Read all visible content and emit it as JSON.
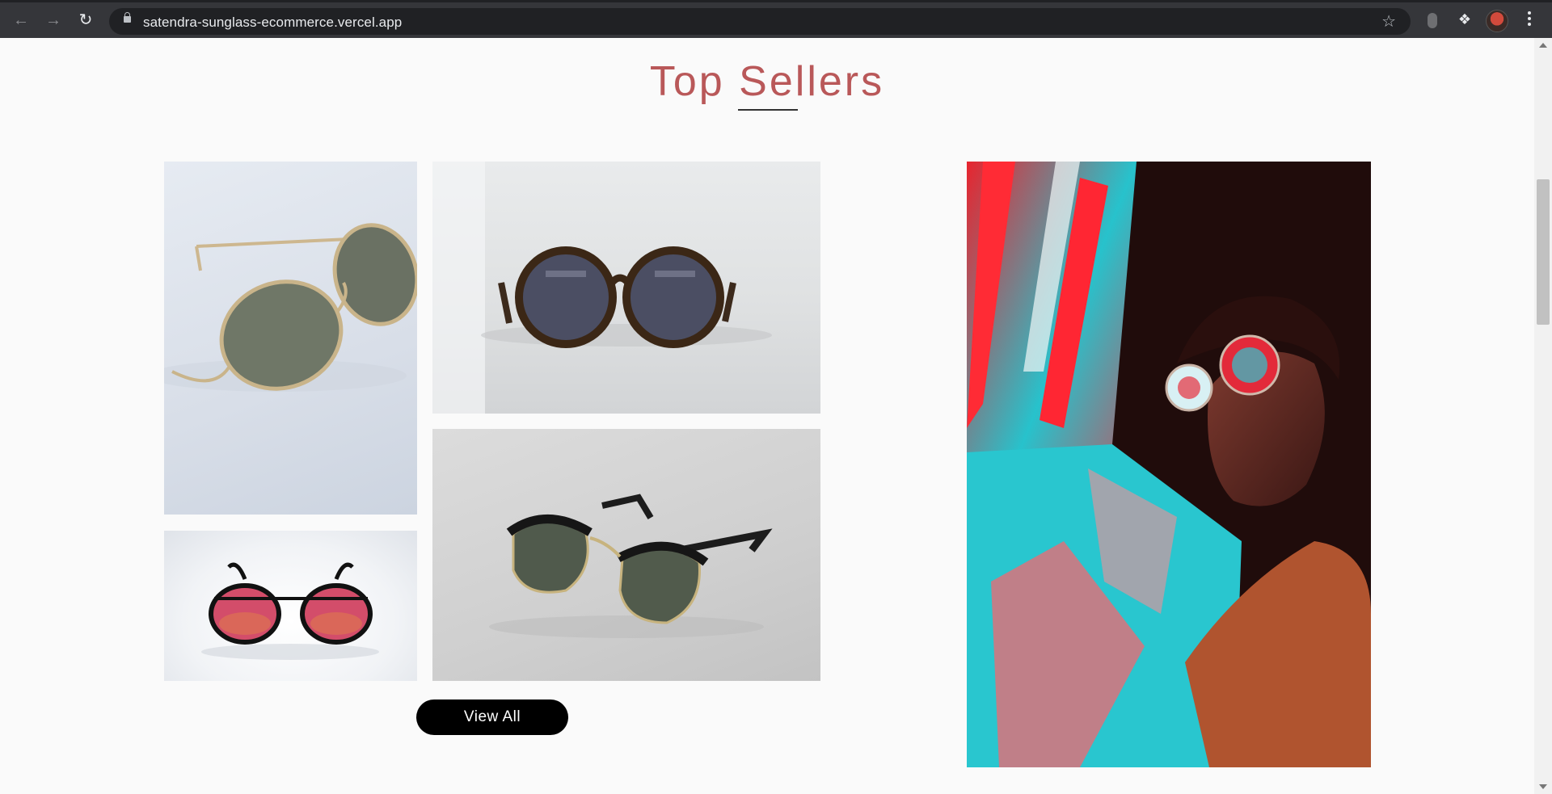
{
  "browser": {
    "url": "satendra-sunglass-ecommerce.vercel.app",
    "icons": [
      "back-icon",
      "forward-icon",
      "reload-icon",
      "lock-icon",
      "star-icon",
      "extension-icon",
      "puzzle-icon",
      "profile-avatar",
      "menu-icon"
    ]
  },
  "section": {
    "title": "Top Sellers",
    "title_color": "#b95859"
  },
  "products": [
    {
      "name": "round gold metal sunglasses"
    },
    {
      "name": "tortoiseshell round sunglasses"
    },
    {
      "name": "pink mirrored aviator sunglasses"
    },
    {
      "name": "black clubmaster sunglasses"
    }
  ],
  "feature_image": {
    "name": "man wearing round mirrored sunglasses in neon light"
  },
  "cta": {
    "view_all_label": "View All"
  }
}
